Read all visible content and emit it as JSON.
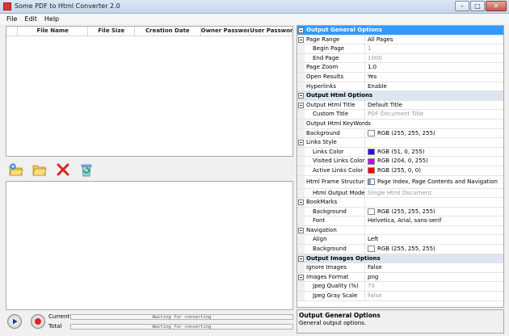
{
  "window": {
    "title": "Some PDF to Html Converter 2.0"
  },
  "menu": [
    "File",
    "Edit",
    "Help"
  ],
  "file_table": {
    "columns": [
      "",
      "File Name",
      "File Size",
      "Creation Date",
      "Owner Password",
      "User Password"
    ]
  },
  "toolbar": [
    "add-file-icon",
    "open-folder-icon",
    "delete-icon",
    "clear-icon"
  ],
  "progress": {
    "current_label": "Current",
    "total_label": "Total",
    "current_status": "Waiting for converting",
    "total_status": "Waiting for converting"
  },
  "properties": {
    "cat_general": "Output General Options",
    "page_range": {
      "name": "Page Range",
      "value": "All Pages"
    },
    "begin_page": {
      "name": "Begin Page",
      "value": "1"
    },
    "end_page": {
      "name": "End Page",
      "value": "1000"
    },
    "page_zoom": {
      "name": "Page Zoom",
      "value": "1.0"
    },
    "open_results": {
      "name": "Open Results",
      "value": "Yes"
    },
    "hyperlinks": {
      "name": "Hyperlinks",
      "value": "Enable"
    },
    "cat_html": "Output Html Options",
    "html_title": {
      "name": "Output Html Title",
      "value": "Default Title"
    },
    "custom_title": {
      "name": "Custom Title",
      "value": "PDF Document Title"
    },
    "html_keywords": {
      "name": "Output Html KeyWords",
      "value": ""
    },
    "background": {
      "name": "Background",
      "value": "RGB (255, 255, 255)",
      "color": "#ffffff"
    },
    "links_style": {
      "name": "Links Style"
    },
    "links_color": {
      "name": "Links Color",
      "value": "RGB (51, 0, 255)",
      "color": "#3300ff"
    },
    "visited_links": {
      "name": "Visited Links Color",
      "value": "RGB (204, 0, 255)",
      "color": "#cc00ff"
    },
    "active_links": {
      "name": "Active Links Color",
      "value": "RGB (255, 0, 0)",
      "color": "#ff0000"
    },
    "frame_structures": {
      "name": "Html Frame Structures",
      "value": "Page Index, Page Contents and Navigation"
    },
    "output_mode": {
      "name": "Html Output Mode",
      "value": "Single Html Document"
    },
    "bookmarks": {
      "name": "BookMarks"
    },
    "bm_background": {
      "name": "Background",
      "value": "RGB (255, 255, 255)",
      "color": "#ffffff"
    },
    "bm_font": {
      "name": "Font",
      "value": "Helvetica, Arial, sans-serif"
    },
    "navigation": {
      "name": "Navigation"
    },
    "nav_align": {
      "name": "Align",
      "value": "Left"
    },
    "nav_background": {
      "name": "Background",
      "value": "RGB (255, 255, 255)",
      "color": "#ffffff"
    },
    "cat_images": "Output Images Options",
    "ignore_images": {
      "name": "Ignore Images",
      "value": "False"
    },
    "images_format": {
      "name": "Images Format",
      "value": "png"
    },
    "jpeg_quality": {
      "name": "Jpeg Quality (%)",
      "value": "70"
    },
    "jpeg_gray": {
      "name": "Jpeg Gray Scale",
      "value": "False"
    }
  },
  "description": {
    "title": "Output General Options",
    "text": "General output options."
  }
}
